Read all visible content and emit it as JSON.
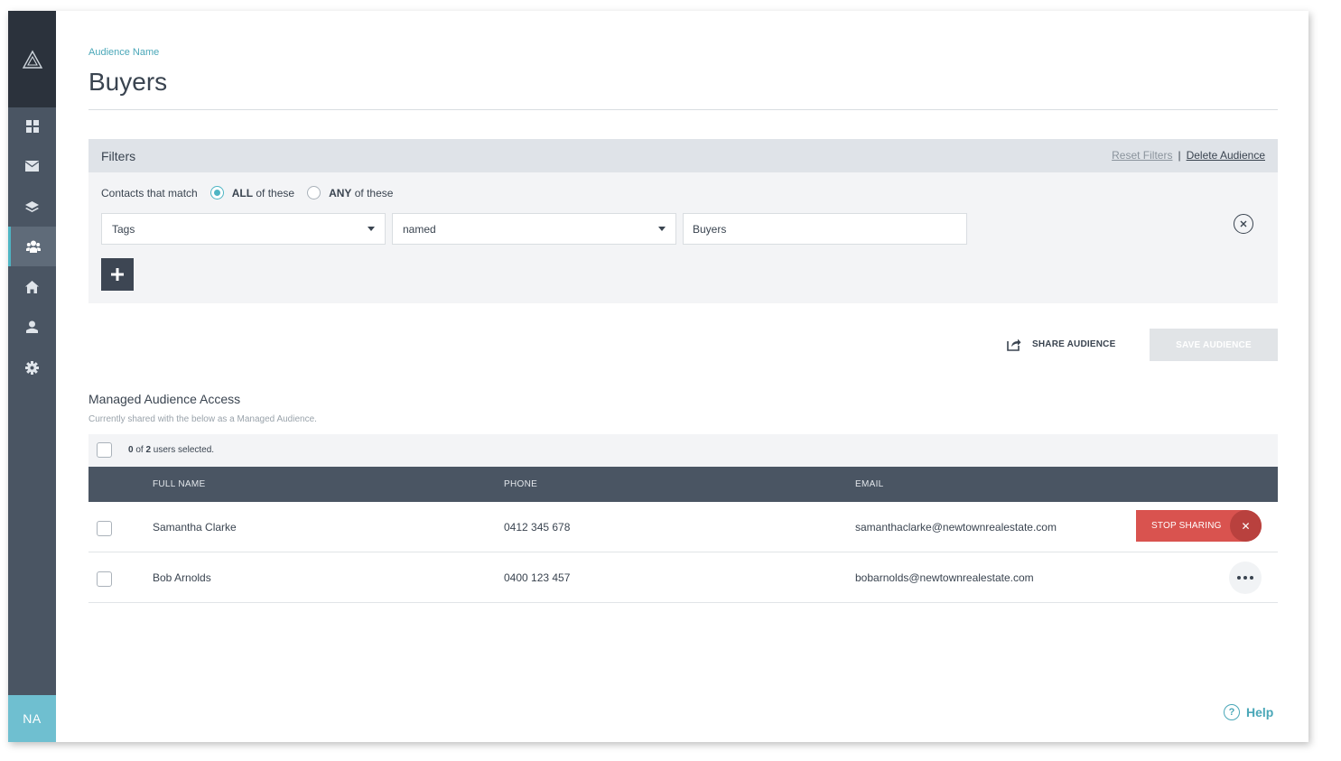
{
  "sidebar": {
    "logo_icon": "triangle-logo-icon",
    "items": [
      {
        "name": "dashboard",
        "icon": "grid-icon",
        "active": false
      },
      {
        "name": "mail",
        "icon": "envelope-icon",
        "active": false
      },
      {
        "name": "layers",
        "icon": "layers-icon",
        "active": false
      },
      {
        "name": "audiences",
        "icon": "people-icon",
        "active": true
      },
      {
        "name": "properties",
        "icon": "home-icon",
        "active": false
      },
      {
        "name": "contacts",
        "icon": "person-icon",
        "active": false
      },
      {
        "name": "settings",
        "icon": "gear-icon",
        "active": false
      }
    ],
    "avatar_initials": "NA"
  },
  "header": {
    "breadcrumb": "Audience Name",
    "title": "Buyers"
  },
  "filters": {
    "title": "Filters",
    "reset_label": "Reset Filters",
    "separator": "|",
    "delete_label": "Delete Audience",
    "match_label": "Contacts that match",
    "match_all_strong": "ALL",
    "match_all_rest": " of these",
    "match_any_strong": "ANY",
    "match_any_rest": " of these",
    "match_selected": "all",
    "field_select": "Tags",
    "operator_select": "named",
    "value_input": "Buyers"
  },
  "actions": {
    "share_label": "SHARE AUDIENCE",
    "save_label": "SAVE AUDIENCE"
  },
  "managed_access": {
    "title": "Managed Audience Access",
    "subtitle": "Currently shared with the below as a Managed Audience.",
    "selected_count": "0",
    "of_text": " of ",
    "total_count": "2",
    "selected_suffix": " users selected.",
    "columns": {
      "name": "FULL NAME",
      "phone": "PHONE",
      "email": "EMAIL"
    },
    "rows": [
      {
        "name": "Samantha Clarke",
        "phone": "0412 345 678",
        "email": "samanthaclarke@newtownrealestate.com",
        "action": "STOP SHARING"
      },
      {
        "name": "Bob Arnolds",
        "phone": "0400 123 457",
        "email": "bobarnolds@newtownrealestate.com",
        "action": "more"
      }
    ]
  },
  "help_label": "Help",
  "colors": {
    "accent": "#4eb5c4",
    "danger": "#d9534f",
    "sidebar": "#4a5563",
    "sidebar_dark": "#2b323c"
  }
}
